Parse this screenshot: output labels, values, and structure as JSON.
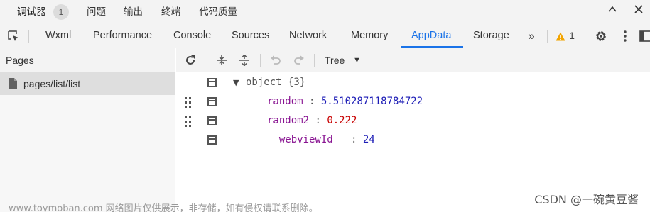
{
  "top_tabs": [
    {
      "label": "调试器",
      "active": true
    },
    {
      "label": "问题"
    },
    {
      "label": "输出"
    },
    {
      "label": "终端"
    },
    {
      "label": "代码质量"
    }
  ],
  "top_badge": "1",
  "window_controls": {
    "collapse_icon": "chevron-up-icon",
    "close_icon": "close-icon"
  },
  "tool_tabs": [
    "Wxml",
    "Performance",
    "Console",
    "Sources",
    "Network",
    "Memory",
    "AppData",
    "Storage"
  ],
  "active_tool_tab": "AppData",
  "more_tabs_symbol": "»",
  "warnings": {
    "icon": "warning-icon",
    "count": "1",
    "color": "#f2a400"
  },
  "accent_color": "#1a73e8",
  "sidebar": {
    "title": "Pages",
    "items": [
      {
        "label": "pages/list/list",
        "icon": "file-icon",
        "selected": true
      }
    ]
  },
  "data_toolbar": {
    "view_mode": "Tree",
    "buttons": [
      "refresh-icon",
      "collapse-all-icon",
      "expand-all-icon",
      "undo-icon",
      "redo-icon"
    ]
  },
  "tree": {
    "root_label": "object {3}",
    "entries": [
      {
        "key": "random",
        "value": "5.510287118784722"
      },
      {
        "key": "random2",
        "value": "0.222"
      },
      {
        "key": "__webviewId__",
        "value": "24"
      }
    ]
  },
  "watermarks": {
    "left": "www.toymoban.com 网络图片仅供展示，非存储，如有侵权请联系删除。",
    "right": "CSDN @一碗黄豆酱"
  }
}
